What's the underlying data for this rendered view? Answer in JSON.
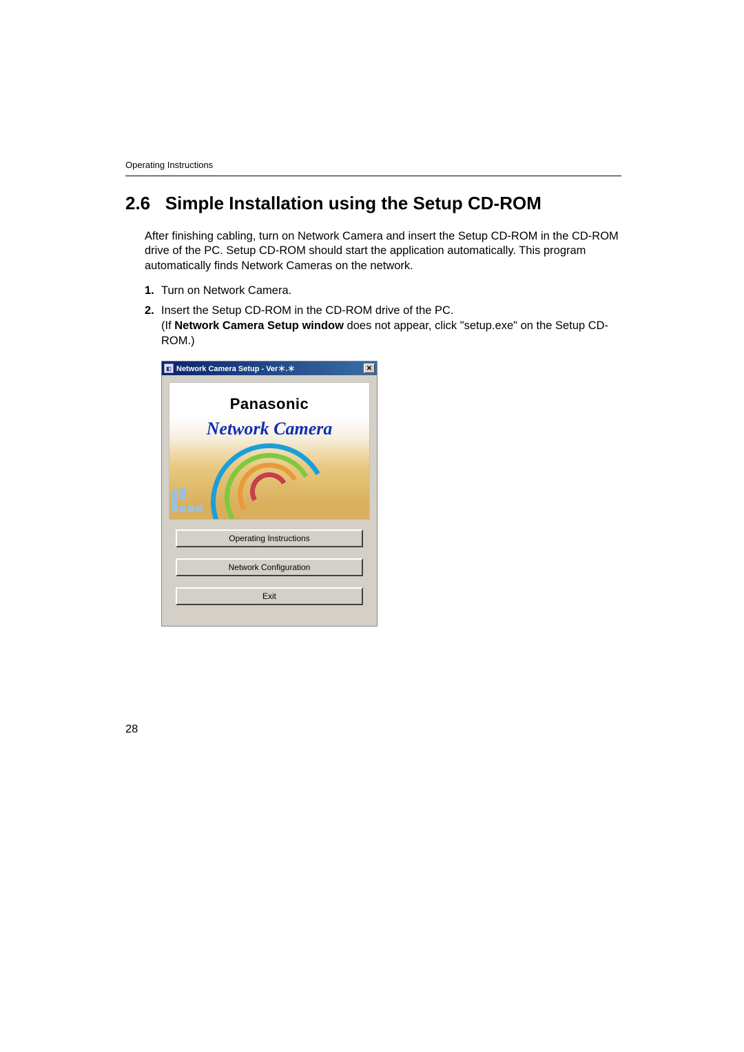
{
  "header": {
    "label": "Operating Instructions"
  },
  "heading": {
    "number": "2.6",
    "title": "Simple Installation using the Setup CD-ROM"
  },
  "intro": "After finishing cabling, turn on Network Camera and insert the Setup CD-ROM in the CD-ROM drive of the PC. Setup CD-ROM should start the application automatically. This program automatically finds Network Cameras on the network.",
  "steps": [
    {
      "num": "1.",
      "text": "Turn on Network Camera."
    },
    {
      "num": "2.",
      "lead": "Insert the Setup CD-ROM in the CD-ROM drive of the PC.",
      "note_prefix": "(If ",
      "note_bold": "Network Camera Setup window",
      "note_suffix": " does not appear, click \"setup.exe\" on the Setup CD-ROM.)"
    }
  ],
  "dialog": {
    "title": "Network Camera Setup  -  Ver＊.＊",
    "close_glyph": "✕",
    "brand": "Panasonic",
    "product": "Network Camera",
    "buttons": {
      "operating": "Operating Instructions",
      "network": "Network Configuration",
      "exit": "Exit"
    }
  },
  "page_number": "28"
}
